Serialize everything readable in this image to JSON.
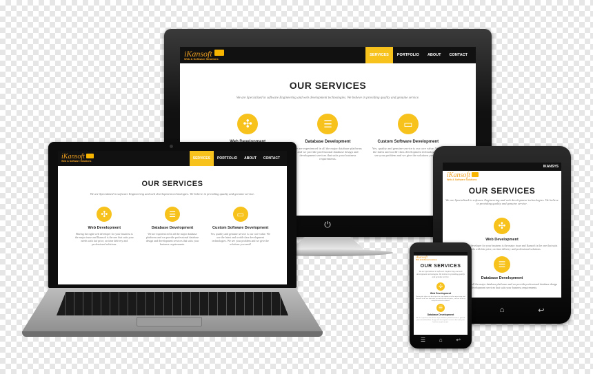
{
  "logo": {
    "name": "iKansoft",
    "tagline": "Web & Software Solutions"
  },
  "nav": {
    "items": [
      "SERVICES",
      "PORTFOLIO",
      "ABOUT",
      "CONTACT"
    ],
    "active": 0
  },
  "hero": {
    "title": "OUR SERVICES",
    "subtitle": "We are Specialized in software Engineering and web development technologies. We believe in providing quality and genuine service."
  },
  "services": [
    {
      "icon": "joomla-icon",
      "title": "Web Development",
      "text": "Having the right web developer for your business is the major issue and Ikansoft is the one that suits your needs with fair price, on time delivery and professional solutions."
    },
    {
      "icon": "database-icon",
      "title": "Database Development",
      "text": "We are experienced in all the major database platforms and we provide professional database design and development services that suits your business requirements."
    },
    {
      "icon": "monitor-icon",
      "title": "Custom Software Development",
      "text": "Yes, quality and genuine service is our core value. We use the latest and world-class development technologies. We see your problem and we give the solutions you need!"
    }
  ],
  "tablet": {
    "nav_label": "IKANSYS"
  },
  "colors": {
    "accent": "#f7c21b",
    "logo": "#f0a020",
    "nav": "#111111"
  }
}
